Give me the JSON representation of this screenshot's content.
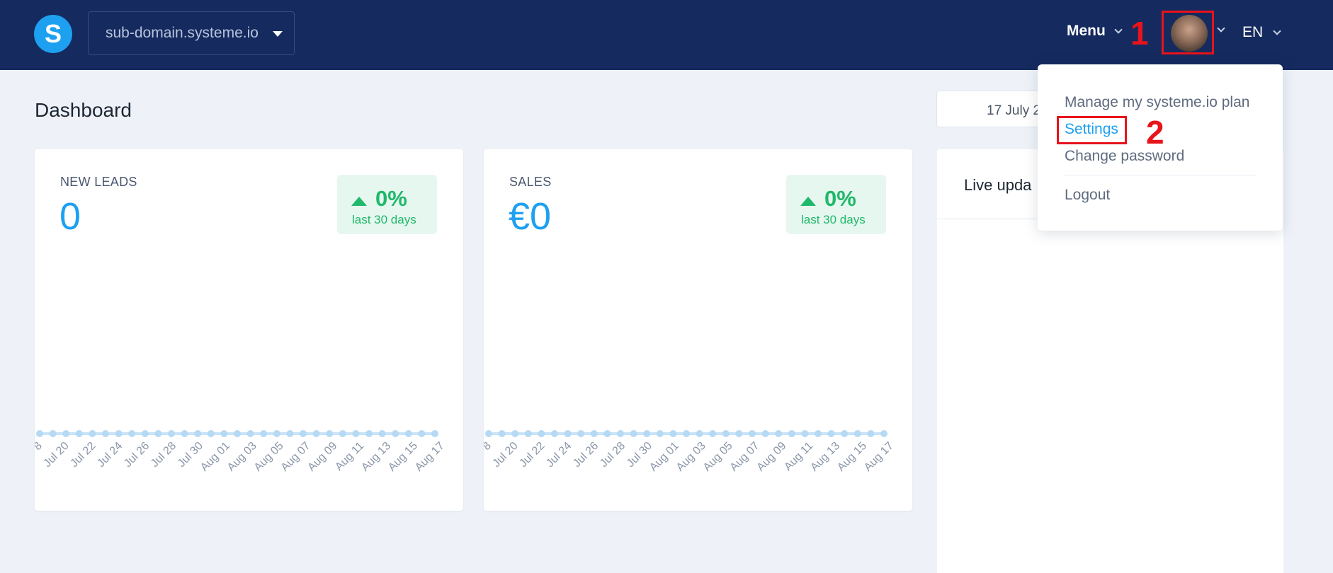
{
  "header": {
    "logo_letter": "S",
    "domain": "sub-domain.systeme.io",
    "menu_label": "Menu",
    "language": "EN"
  },
  "annotations": {
    "step1": "1",
    "step2": "2"
  },
  "page": {
    "title": "Dashboard",
    "date_range": "17 July 2"
  },
  "cards": {
    "leads": {
      "label": "NEW LEADS",
      "value": "0",
      "change": "0%",
      "period": "last 30 days"
    },
    "sales": {
      "label": "SALES",
      "value": "€0",
      "change": "0%",
      "period": "last 30 days"
    },
    "live": {
      "title": "Live upda"
    }
  },
  "dropdown": {
    "items": [
      "Manage my systeme.io plan",
      "Settings",
      "Change password",
      "Logout"
    ]
  },
  "colors": {
    "brand_blue": "#1ea0f0",
    "navy": "#152a5e",
    "positive": "#20b86a",
    "annotation_red": "#e8131b"
  },
  "chart_data": [
    {
      "type": "line",
      "x": [
        "8",
        "Jul 20",
        "Jul 22",
        "Jul 24",
        "Jul 26",
        "Jul 28",
        "Jul 30",
        "Aug 01",
        "Aug 03",
        "Aug 05",
        "Aug 07",
        "Aug 09",
        "Aug 11",
        "Aug 13",
        "Aug 15",
        "Aug 17"
      ],
      "series": [
        {
          "values": [
            0,
            0,
            0,
            0,
            0,
            0,
            0,
            0,
            0,
            0,
            0,
            0,
            0,
            0,
            0,
            0,
            0,
            0,
            0,
            0,
            0,
            0,
            0,
            0,
            0,
            0,
            0,
            0,
            0,
            0,
            0
          ]
        }
      ]
    },
    {
      "type": "line",
      "x": [
        "8",
        "Jul 20",
        "Jul 22",
        "Jul 24",
        "Jul 26",
        "Jul 28",
        "Jul 30",
        "Aug 01",
        "Aug 03",
        "Aug 05",
        "Aug 07",
        "Aug 09",
        "Aug 11",
        "Aug 13",
        "Aug 15",
        "Aug 17"
      ],
      "series": [
        {
          "values": [
            0,
            0,
            0,
            0,
            0,
            0,
            0,
            0,
            0,
            0,
            0,
            0,
            0,
            0,
            0,
            0,
            0,
            0,
            0,
            0,
            0,
            0,
            0,
            0,
            0,
            0,
            0,
            0,
            0,
            0,
            0
          ]
        }
      ]
    }
  ]
}
